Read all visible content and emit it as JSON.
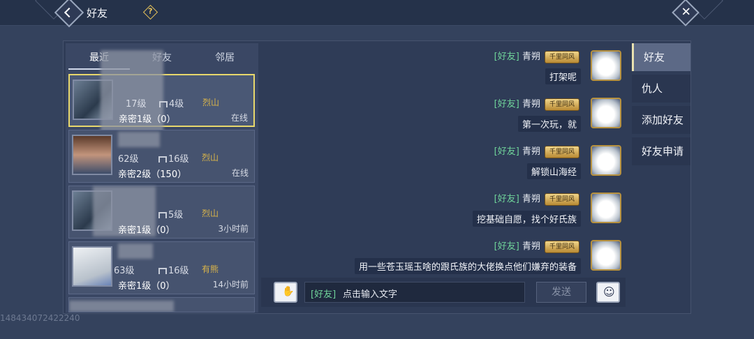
{
  "header": {
    "title": "好友"
  },
  "tabs": [
    {
      "label": "最近"
    },
    {
      "label": "好友"
    },
    {
      "label": "邻居"
    }
  ],
  "friends": [
    {
      "level": "17级",
      "home_level": "4级",
      "sect": "烈山",
      "intimacy": "亲密1级（0）",
      "status": "在线",
      "avatar": "avatar-landscape",
      "selected": true
    },
    {
      "level": "62级",
      "home_level": "16级",
      "sect": "烈山",
      "intimacy": "亲密2级（150）",
      "status": "在线",
      "avatar": "avatar-face"
    },
    {
      "level": "",
      "home_level": "5级",
      "sect": "烈山",
      "intimacy": "亲密1级（0）",
      "status": "3小时前",
      "avatar": "avatar-landscape"
    },
    {
      "level": "63级",
      "home_level": "16级",
      "sect": "有熊",
      "intimacy": "亲密1级（0）",
      "status": "14小时前",
      "avatar": "avatar-fox"
    }
  ],
  "messages": [
    {
      "tag": "[好友]",
      "sender": "青朔",
      "badge": "千里同风",
      "text": "打架呢"
    },
    {
      "tag": "[好友]",
      "sender": "青朔",
      "badge": "千里同风",
      "text": "第一次玩，就"
    },
    {
      "tag": "[好友]",
      "sender": "青朔",
      "badge": "千里同风",
      "text": "解锁山海经"
    },
    {
      "tag": "[好友]",
      "sender": "青朔",
      "badge": "千里同风",
      "text": "挖基础自愿，找个好氏族"
    },
    {
      "tag": "[好友]",
      "sender": "青朔",
      "badge": "千里同风",
      "text": "用一些苍玉瑶玉啥的跟氏族的大佬换点他们嫌弃的装备"
    }
  ],
  "input": {
    "channel_tag": "[好友]",
    "placeholder": "点击输入文字",
    "send_label": "发送"
  },
  "side_tabs": [
    {
      "label": "好友",
      "active": true
    },
    {
      "label": "仇人"
    },
    {
      "label": "添加好友"
    },
    {
      "label": "好友申请"
    }
  ],
  "watermark": "148434072422240",
  "colors": {
    "accent_gold": "#e8d86c",
    "friend_tag": "#6fd39a",
    "sect": "#d9b44a"
  }
}
